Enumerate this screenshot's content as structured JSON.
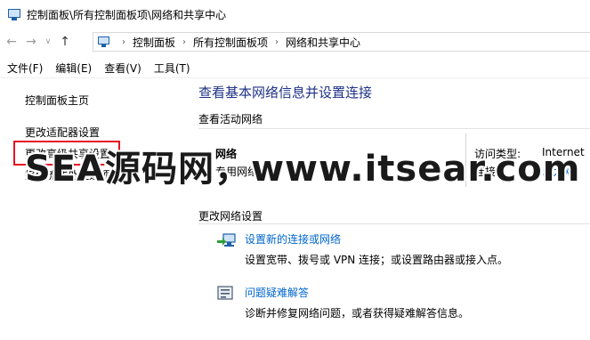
{
  "window": {
    "title": "控制面板\\所有控制面板项\\网络和共享中心"
  },
  "nav": {
    "back": "←",
    "forward": "→",
    "recent": "∨",
    "up": "↑",
    "breadcrumbs": [
      "控制面板",
      "所有控制面板项",
      "网络和共享中心"
    ],
    "separator": "›"
  },
  "menu": [
    "文件(F)",
    "编辑(E)",
    "查看(V)",
    "工具(T)"
  ],
  "sidebar": {
    "items": [
      {
        "label": "控制面板主页"
      },
      {
        "label": "更改适配器设置"
      },
      {
        "label": "更改高级共享设置"
      },
      {
        "label": "媒体流式处理选项"
      }
    ]
  },
  "main": {
    "title": "查看基本网络信息并设置连接",
    "active_networks_label": "查看活动网络",
    "network": {
      "name": "网络",
      "type": "专用网络",
      "access_type_label": "访问类型:",
      "access_type_value": "Internet",
      "connections_label": "连接:",
      "connections_value": "以太网"
    },
    "change_settings_label": "更改网络设置",
    "tasks": [
      {
        "icon": "network-setup-icon",
        "link": "设置新的连接或网络",
        "desc": "设置宽带、拨号或 VPN 连接；或设置路由器或接入点。"
      },
      {
        "icon": "troubleshoot-icon",
        "link": "问题疑难解答",
        "desc": "诊断并修复网络问题，或者获得疑难解答信息。"
      }
    ]
  },
  "watermark": "SEA源码网，www.itsear.com"
}
